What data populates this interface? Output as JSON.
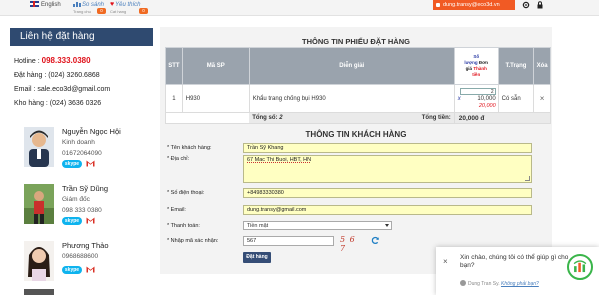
{
  "topbar": {
    "language": "English",
    "compare_label": "So sánh",
    "compare_count": "0",
    "favorite_label": "Yêu thích",
    "favorite_count": "0",
    "user_email": "dung.transy@eco3d.vn",
    "compare_sub": "Trang chu",
    "favorite_sub": "Cat hang"
  },
  "sidebar": {
    "title": "Liên hệ đặt hàng",
    "hotline_label": "Hotline : ",
    "hotline": "098.333.0380",
    "order_line": "Đặt hàng : (024) 3260.6868",
    "email_line": "Email : sale.eco3d@gmail.com",
    "warehouse_line": "Kho hàng : (024) 3636 0326",
    "contacts": [
      {
        "name": "Nguyễn Ngọc Hội",
        "role": "Kinh doanh",
        "phone": "01672064090"
      },
      {
        "name": "Trần Sỹ Dũng",
        "role": "Giám đốc",
        "phone": "098 333 0380"
      },
      {
        "name": "Phương Thảo",
        "role": "",
        "phone": "0968688600"
      }
    ],
    "skype_label": "skype"
  },
  "order": {
    "title": "THÔNG TIN PHIẾU ĐẶT HÀNG",
    "columns": {
      "stt": "STT",
      "code": "Mã SP",
      "desc": "Diễn giải",
      "qty_l1": "Số",
      "qty_l2": "lượng",
      "qty_l3": "Đơn",
      "qty_l4": "giá",
      "qty_l5": "Thành",
      "qty_l6": "tiền",
      "status": "T.Trạng",
      "delete": "Xóa"
    },
    "row": {
      "stt": "1",
      "code": "H930",
      "desc": "Khẩu trang chống bụi H930",
      "qty": "2",
      "multiply": "x",
      "unit_price": "10,000",
      "line_total": "20,000",
      "status": "Có sẵn",
      "delete": "×"
    },
    "total_count_label": "Tổng số: ",
    "total_count": "2",
    "total_money_label": "Tổng tiền:",
    "total_money": "20,000 đ"
  },
  "customer": {
    "title": "THÔNG TIN KHÁCH HÀNG",
    "name_label": "* Tên khách hàng:",
    "name_value": "Trần Sỹ Khang",
    "address_label": "* Địa chỉ:",
    "address_value": "67 Mac Thi Buoi, HBT, HN",
    "phone_label": "* Số điện thoại:",
    "phone_value": "+84983330380",
    "email_label": "* Email:",
    "email_value": "dung.transy@gmail.com",
    "payment_label": "* Thanh toán:",
    "payment_value": "Tiền mặt",
    "captcha_label": "* Nhập mã xác nhận:",
    "captcha_value": "567",
    "captcha_image": "5 6 7",
    "submit": "Đặt hàng"
  },
  "chat": {
    "message": "Xin chào, chúng tôi có thể giúp gì cho bạn?",
    "agent": "Dung Tran Sy",
    "reply_link": "Không phải bạn?",
    "close": "×"
  },
  "colors": {
    "accent": "#f15a24",
    "header_blue": "#2f4a70",
    "hotline_red": "#e0121b",
    "input_yellow": "#ffffc2"
  }
}
